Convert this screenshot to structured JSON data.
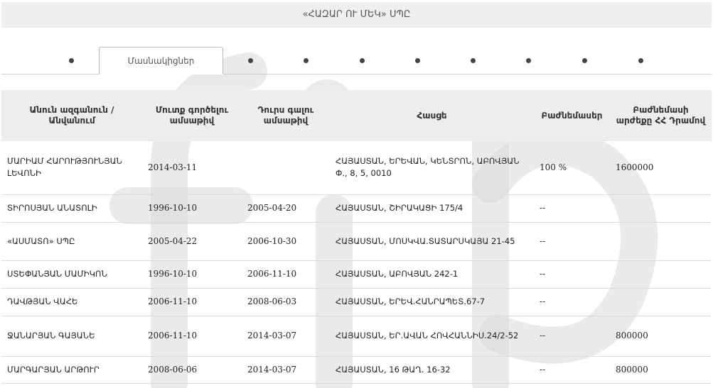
{
  "page_title": "«ՀԱԶԱՐ ՈՒ ՄԵԿ» ՍՊԸ",
  "tabs": {
    "active_label": "Մասնակիցներ",
    "dot_count": 10
  },
  "table": {
    "headers": [
      "Անուն ազգանուն / Անվանում",
      "Մուտք գործելու ամսաթիվ",
      "Դուրս գալու ամսաթիվ",
      "Հասցե",
      "Բաժնեմասեր",
      "Բաժնեմասի արժեքը ՀՀ Դրամով"
    ],
    "rows": [
      {
        "name": "ՄԱՐԻԱՄ ՀԱՐՈՒԹՅՈՒՆՅԱՆ ԼԵՎՈՆԻ",
        "entry": "2014-03-11",
        "exit": "",
        "address": "ՀԱՅԱՍՏԱՆ, ԵՐԵՎԱՆ, ԿԵՆՏՐՈՆ, ԱԲՈՎՅԱՆ Փ., 8, 5, 0010",
        "share": "100 %",
        "value": "1600000"
      },
      {
        "name": "ՏԻՐՈՍՅԱՆ ԱՆԱՏՈԼԻ",
        "entry": "1996-10-10",
        "exit": "2005-04-20",
        "address": "ՀԱՅԱՍՏԱՆ, ՇԻՐԱԿԱՑԻ 175/4",
        "share": "--",
        "value": ""
      },
      {
        "name": "«ԱՍՄԱՏՈ» ՍՊԸ",
        "entry": "2005-04-22",
        "exit": "2006-10-30",
        "address": "ՀԱՅԱՍՏԱՆ, ՄՈՍԿՎԱ.ՏԱՏԱՐՍԿԱՅԱ 21-45",
        "share": "--",
        "value": ""
      },
      {
        "name": "ՍՏԵՓԱՆՅԱՆ ՄԱՄԻԿՈՆ",
        "entry": "1996-10-10",
        "exit": "2006-11-10",
        "address": "ՀԱՅԱՍՏԱՆ, ԱԲՈՎՅԱՆ 242-1",
        "share": "--",
        "value": ""
      },
      {
        "name": "ԴԱՎԹՅԱՆ ՎԱՀԵ",
        "entry": "2006-11-10",
        "exit": "2008-06-03",
        "address": "ՀԱՅԱՍՏԱՆ, ԵՐԵՎ.ՀԱՆՐԱՊԵՏ.67-7",
        "share": "--",
        "value": ""
      },
      {
        "name": "ՋԱՆԱՐՅԱՆ ԳԱՅԱՆԵ",
        "entry": "2006-11-10",
        "exit": "2014-03-07",
        "address": "ՀԱՅԱՍՏԱՆ, ԵՐ.ԱՎԱՆ ՀՈՎՀԱՆՆԻՍ.24/2-52",
        "share": "--",
        "value": "800000"
      },
      {
        "name": "ՄԱՐԳԱՐՅԱՆ ԱՐԹՈՒՐ",
        "entry": "2008-06-06",
        "exit": "2014-03-07",
        "address": "ՀԱՅԱՍՏԱՆ, 16 ԹԱՂ. 16-32",
        "share": "--",
        "value": "800000"
      }
    ]
  }
}
